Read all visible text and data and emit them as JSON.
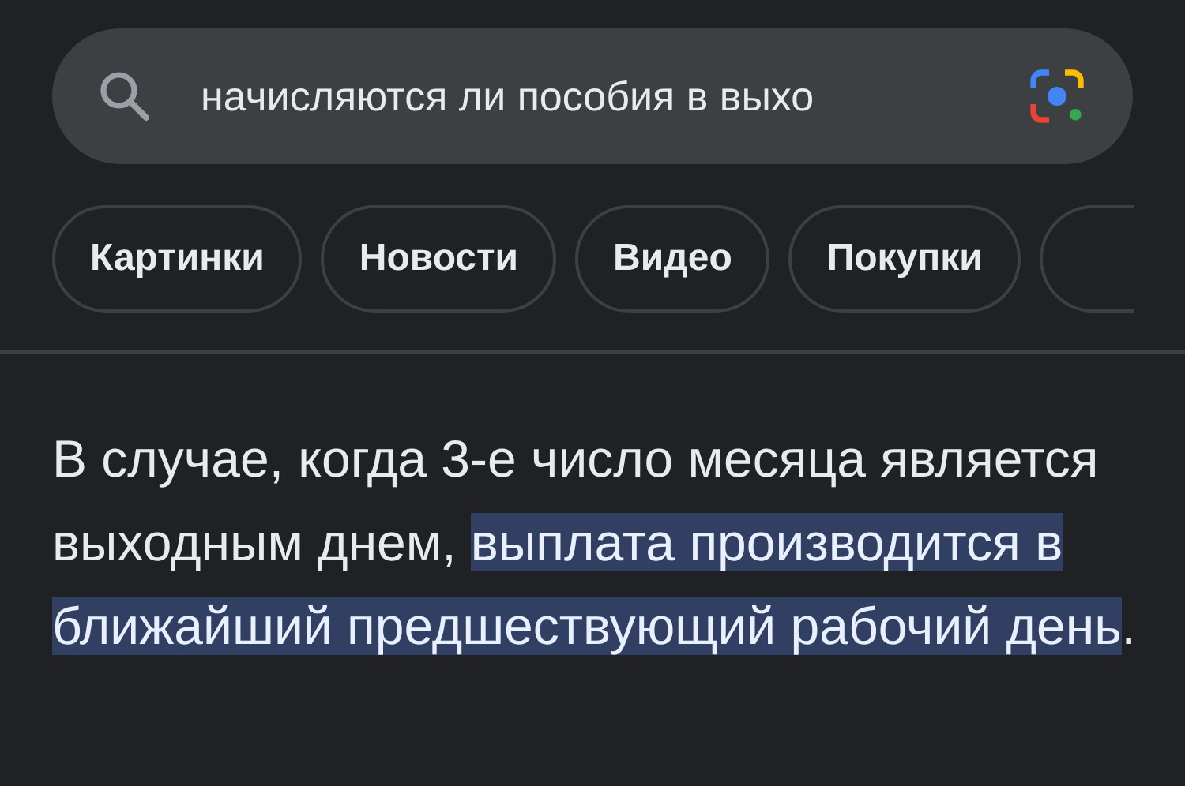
{
  "search": {
    "query": "начисляются ли пособия в выхо"
  },
  "chips": [
    {
      "label": "Картинки"
    },
    {
      "label": "Новости"
    },
    {
      "label": "Видео"
    },
    {
      "label": "Покупки"
    }
  ],
  "answer": {
    "text_before": "В случае, когда 3-е число месяца является выходным днем, ",
    "highlight": "выплата производится в ближайший предшествующий рабочий день",
    "text_after": "."
  }
}
